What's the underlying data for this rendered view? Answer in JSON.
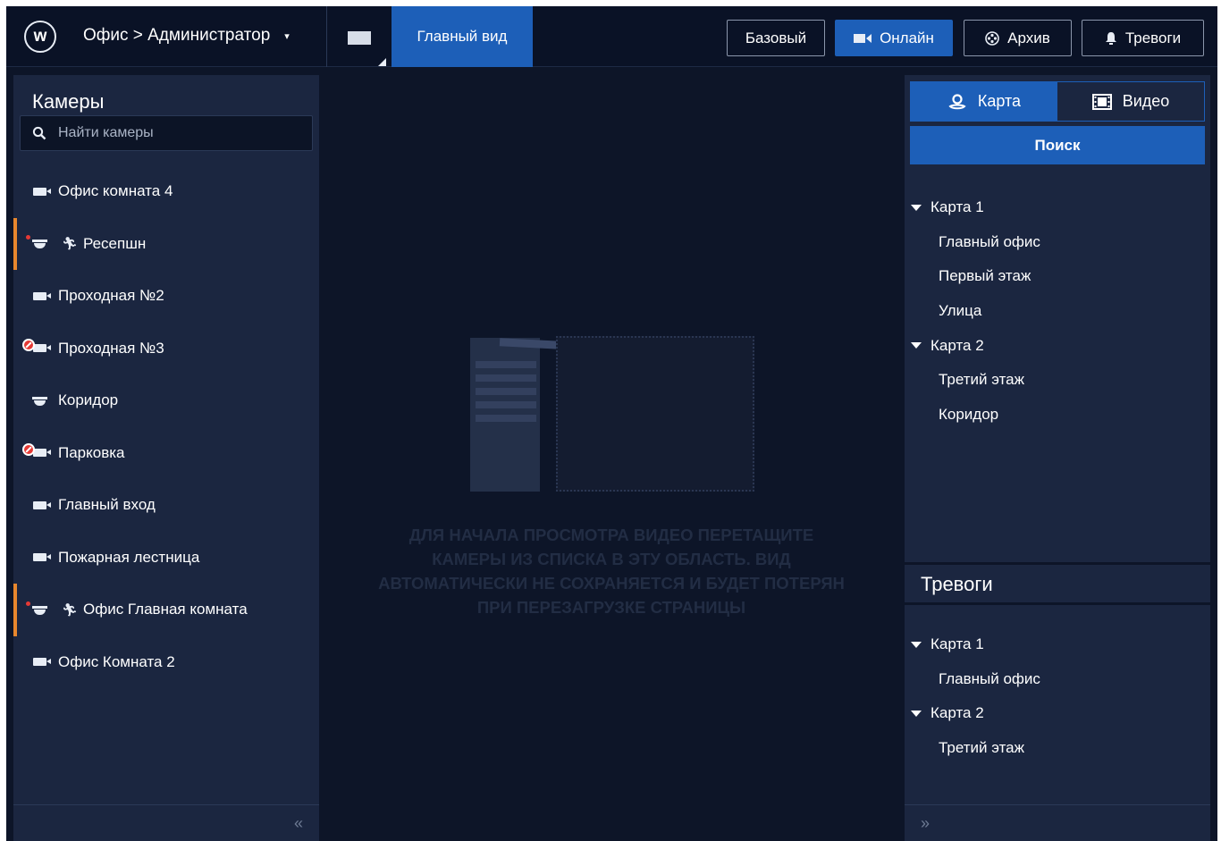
{
  "header": {
    "logo_letter": "w",
    "breadcrumb": "Офис > Администратор",
    "view_tab": "Главный вид",
    "buttons": {
      "basic": "Базовый",
      "online": "Онлайн",
      "archive": "Архив",
      "alarms": "Тревоги"
    },
    "icons": {
      "caret": "▾",
      "online": "video-camera-icon",
      "archive": "film-reel-icon",
      "alarms": "bell-icon"
    }
  },
  "cameras": {
    "title": "Камеры",
    "search_placeholder": "Найти камеры",
    "items": [
      {
        "label": "Офис комната 4",
        "icon": "camera-icon"
      },
      {
        "label": "Ресепшн",
        "icon": "dome-camera-icon",
        "marked": true,
        "motion": true
      },
      {
        "label": "Проходная №2",
        "icon": "camera-icon"
      },
      {
        "label": "Проходная №3",
        "icon": "camera-offline-icon"
      },
      {
        "label": "Коридор",
        "icon": "dome-camera-icon"
      },
      {
        "label": "Парковка",
        "icon": "camera-offline-icon"
      },
      {
        "label": "Главный вход",
        "icon": "camera-icon"
      },
      {
        "label": "Пожарная лестница",
        "icon": "camera-icon"
      },
      {
        "label": "Офис Главная комната",
        "icon": "dome-camera-icon",
        "marked": true,
        "motion": true
      },
      {
        "label": "Офис Комната 2",
        "icon": "camera-icon"
      }
    ],
    "collapse_glyph": "«",
    "alert_color": "#e8872d"
  },
  "center": {
    "drop_hint": "Для начала просмотра видео перетащите камеры из списка в эту область. Вид автоматически не сохраняется и будет потерян при перезагрузке страницы"
  },
  "right": {
    "tabs": {
      "map": "Карта",
      "video": "Видео"
    },
    "search_button": "Поиск",
    "maps": [
      {
        "name": "Карта 1",
        "children": [
          "Главный офис",
          "Первый этаж",
          "Улица"
        ]
      },
      {
        "name": "Карта 2",
        "children": [
          "Третий этаж",
          "Коридор"
        ]
      }
    ],
    "alarms_title": "Тревоги",
    "alarm_maps": [
      {
        "name": "Карта 1",
        "children": [
          "Главный офис"
        ]
      },
      {
        "name": "Карта 2",
        "children": [
          "Третий этаж"
        ]
      }
    ],
    "expand_glyph": "»"
  },
  "colors": {
    "accent": "#1d5fb8",
    "background": "#0d1528",
    "panel": "#1b2640",
    "offline": "#e53935"
  }
}
